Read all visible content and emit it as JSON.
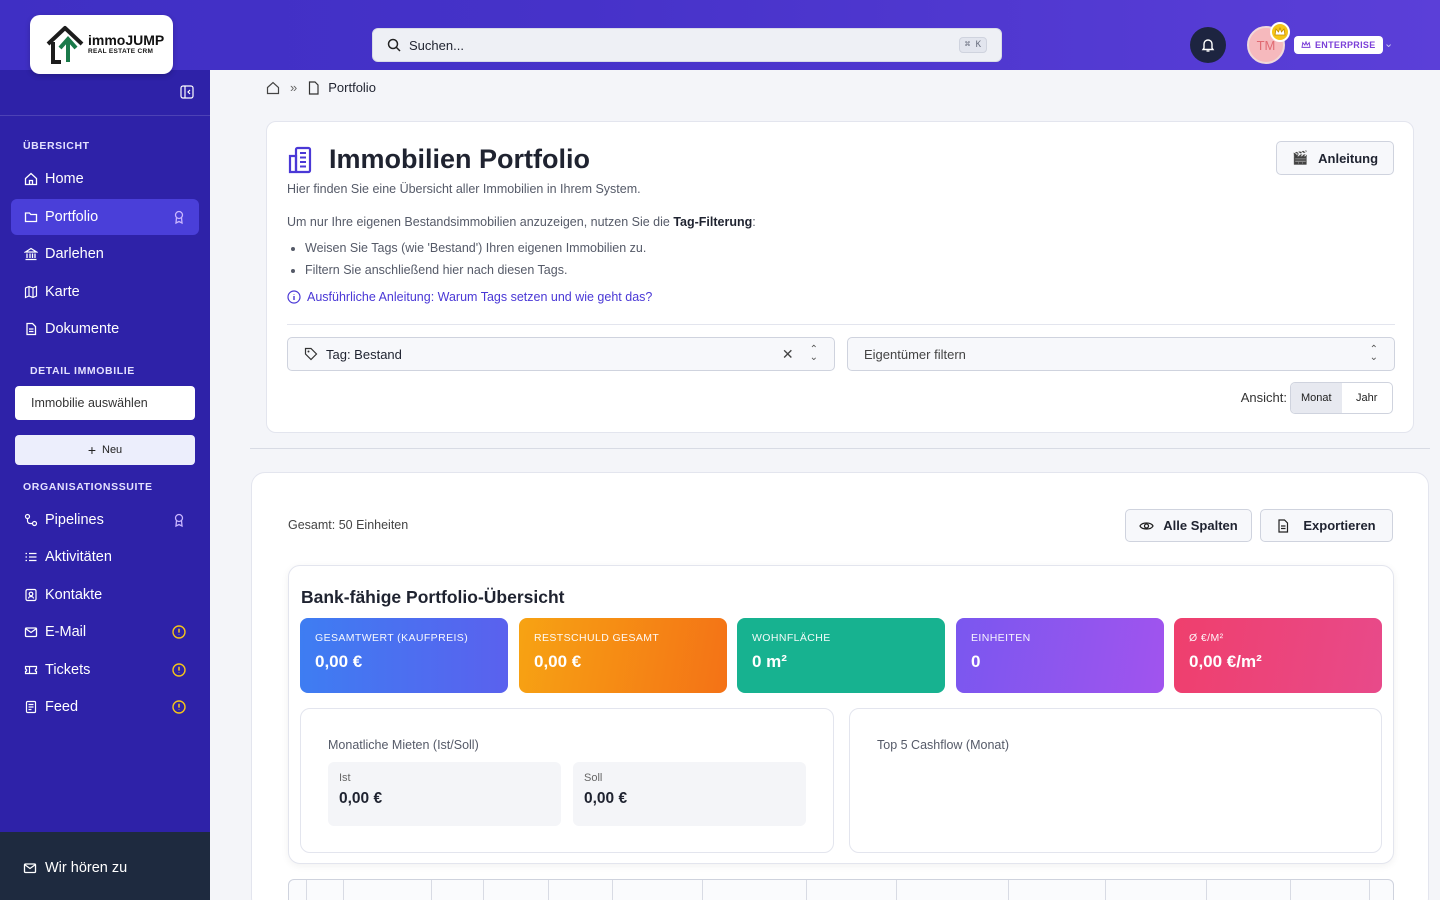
{
  "brand": {
    "name": "immoJUMP",
    "tagline": "REAL ESTATE CRM"
  },
  "search": {
    "placeholder": "Suchen...",
    "shortcut": "⌘ K"
  },
  "user": {
    "initials": "TM",
    "plan": "ENTERPRISE"
  },
  "sidebar": {
    "sections": {
      "overview": "ÜBERSICHT",
      "detail": "DETAIL IMMOBILIE",
      "org": "ORGANISATIONSSUITE"
    },
    "items": [
      {
        "label": "Home",
        "icon": "home-icon"
      },
      {
        "label": "Portfolio",
        "icon": "folder-icon",
        "active": true
      },
      {
        "label": "Darlehen",
        "icon": "bank-icon"
      },
      {
        "label": "Karte",
        "icon": "map-icon"
      },
      {
        "label": "Dokumente",
        "icon": "document-icon"
      }
    ],
    "property_select": "Immobilie auswählen",
    "new_button": "Neu",
    "org_items": [
      {
        "label": "Pipelines",
        "icon": "pipeline-icon"
      },
      {
        "label": "Aktivitäten",
        "icon": "list-icon"
      },
      {
        "label": "Kontakte",
        "icon": "contact-icon"
      },
      {
        "label": "E-Mail",
        "icon": "mail-icon"
      },
      {
        "label": "Tickets",
        "icon": "ticket-icon"
      },
      {
        "label": "Feed",
        "icon": "feed-icon"
      }
    ],
    "footer": "Wir hören zu"
  },
  "breadcrumb": {
    "current": "Portfolio"
  },
  "header": {
    "title": "Immobilien Portfolio",
    "subtitle": "Hier finden Sie eine Übersicht aller Immobilien in Ihrem System.",
    "guide_button": "Anleitung",
    "intro_pre": "Um nur Ihre eigenen Bestandsimmobilien anzuzeigen, nutzen Sie die ",
    "intro_bold": "Tag-Filterung",
    "intro_post": ":",
    "bullets": [
      "Weisen Sie Tags (wie 'Bestand') Ihren eigenen Immobilien zu.",
      "Filtern Sie anschließend hier nach diesen Tags."
    ],
    "help_link": "Ausführliche Anleitung: Warum Tags setzen und wie geht das?"
  },
  "filters": {
    "tag_value": "Tag: Bestand",
    "owner_placeholder": "Eigentümer filtern",
    "view_label": "Ansicht:",
    "view_options": [
      "Monat",
      "Jahr"
    ]
  },
  "portfolio": {
    "total": "Gesamt: 50 Einheiten",
    "columns_button": "Alle Spalten",
    "export_button": "Exportieren",
    "overview_title": "Bank-fähige Portfolio-Übersicht",
    "kpis": [
      {
        "label": "GESAMTWERT (KAUFPREIS)",
        "value": "0,00 €"
      },
      {
        "label": "RESTSCHULD GESAMT",
        "value": "0,00 €"
      },
      {
        "label": "WOHNFLÄCHE",
        "value": "0 m²"
      },
      {
        "label": "EINHEITEN",
        "value": "0"
      },
      {
        "label": "Ø €/M²",
        "value": "0,00 €/m²"
      }
    ],
    "rent": {
      "title": "Monatliche Mieten (Ist/Soll)",
      "ist_label": "Ist",
      "ist_value": "0,00 €",
      "soll_label": "Soll",
      "soll_value": "0,00 €"
    },
    "cashflow_title": "Top 5 Cashflow (Monat)"
  }
}
